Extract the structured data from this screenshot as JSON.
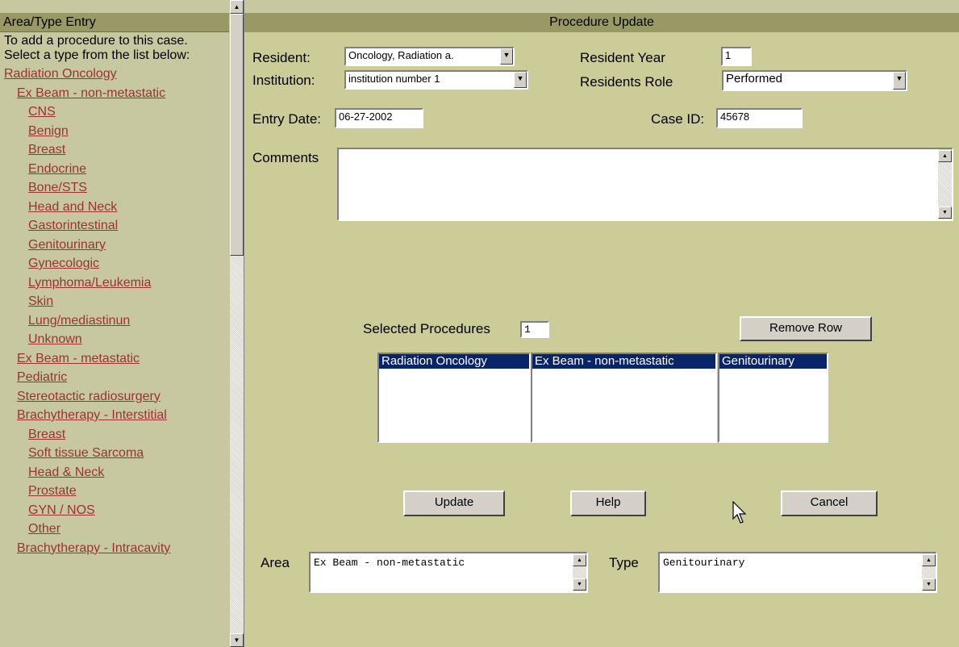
{
  "left_panel": {
    "header": "Area/Type Entry",
    "intro_lines": [
      "To add a procedure to this case.",
      "Select a type from the list below:"
    ],
    "links": [
      {
        "label": "Radiation Oncology",
        "level": 0
      },
      {
        "label": "Ex Beam - non-metastatic",
        "level": 1
      },
      {
        "label": "CNS",
        "level": 2
      },
      {
        "label": "Benign",
        "level": 2
      },
      {
        "label": "Breast",
        "level": 2
      },
      {
        "label": "Endocrine",
        "level": 2
      },
      {
        "label": "Bone/STS",
        "level": 2
      },
      {
        "label": "Head and Neck",
        "level": 2
      },
      {
        "label": "Gastorintestinal",
        "level": 2
      },
      {
        "label": "Genitourinary",
        "level": 2
      },
      {
        "label": "Gynecologic",
        "level": 2
      },
      {
        "label": "Lymphoma/Leukemia",
        "level": 2
      },
      {
        "label": "Skin",
        "level": 2
      },
      {
        "label": "Lung/mediastinun",
        "level": 2
      },
      {
        "label": "Unknown",
        "level": 2
      },
      {
        "label": "Ex Beam - metastatic",
        "level": 1
      },
      {
        "label": "Pediatric",
        "level": 1
      },
      {
        "label": "Stereotactic radiosurgery",
        "level": 1
      },
      {
        "label": "Brachytherapy - Interstitial",
        "level": 1
      },
      {
        "label": "Breast",
        "level": 2
      },
      {
        "label": "Soft tissue Sarcoma",
        "level": 2
      },
      {
        "label": "Head & Neck",
        "level": 2
      },
      {
        "label": "Prostate",
        "level": 2
      },
      {
        "label": "GYN / NOS",
        "level": 2
      },
      {
        "label": "Other",
        "level": 2
      },
      {
        "label": "Brachytherapy - Intracavity",
        "level": 1
      }
    ]
  },
  "form": {
    "title": "Procedure Update",
    "resident_label": "Resident:",
    "resident_value": "Oncology, Radiation a.",
    "institution_label": "Institution:",
    "institution_value": "institution number 1",
    "resident_year_label": "Resident Year",
    "resident_year_value": "1",
    "residents_role_label": "Residents Role",
    "residents_role_value": "Performed",
    "entry_date_label": "Entry Date:",
    "entry_date_value": "06-27-2002",
    "case_id_label": "Case ID:",
    "case_id_value": "45678",
    "comments_label": "Comments",
    "comments_value": "",
    "selected_procedures_label": "Selected Procedures",
    "selected_procedures_count": "1",
    "remove_row_label": "Remove Row",
    "selected_lists": [
      "Radiation Oncology",
      "Ex Beam - non-metastatic",
      "Genitourinary"
    ],
    "update_label": "Update",
    "help_label": "Help",
    "cancel_label": "Cancel",
    "area_label": "Area",
    "area_value": "Ex Beam - non-metastatic",
    "type_label": "Type",
    "type_value": "Genitourinary"
  },
  "colors": {
    "link": "#993333",
    "header": "#999966",
    "panel": "#cccc99",
    "selection": "#0a246a"
  },
  "icons": {
    "scroll_up": "up-arrow-icon",
    "scroll_down": "down-arrow-icon",
    "dropdown": "chevron-down-icon",
    "cursor": "mouse-pointer-icon"
  }
}
